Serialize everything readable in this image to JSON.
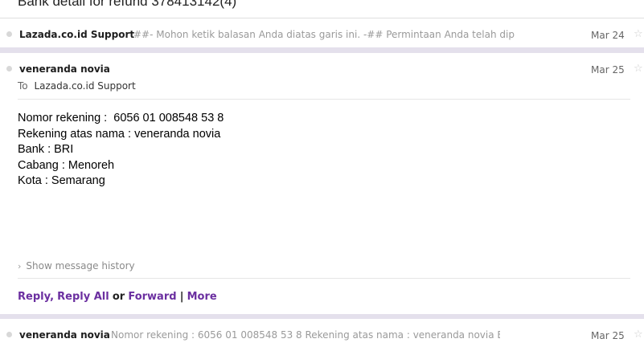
{
  "thread": {
    "subject": "Bank detail for refund 378413142(4)"
  },
  "messages": [
    {
      "sender": "Lazada.co.id Support",
      "snippet": "##- Mohon ketik balasan Anda diatas garis ini. -## Permintaan Anda telah dip",
      "date": "Mar 24"
    },
    {
      "sender": "veneranda novia",
      "date": "Mar 25",
      "to_label": "To",
      "to_value": "Lazada.co.id Support",
      "body": [
        "Nomor rekening :  6056 01 008548 53 8",
        "Rekening atas nama : veneranda novia",
        "Bank : BRI",
        "Cabang : Menoreh",
        "Kota : Semarang"
      ],
      "show_history": "Show message history",
      "actions": {
        "reply": "Reply",
        "comma": ",",
        "reply_all": "Reply All",
        "or": "or",
        "forward": "Forward",
        "pipe": "|",
        "more": "More"
      }
    },
    {
      "sender": "veneranda novia",
      "snippet": "Nomor rekening : 6056 01 008548 53 8 Rekening atas nama : veneranda novia Banl",
      "date": "Mar 25"
    }
  ],
  "icons": {
    "star": "☆",
    "chevron": "›"
  },
  "colors": {
    "link": "#6b2fa0",
    "separator": "#e4e0ec"
  }
}
